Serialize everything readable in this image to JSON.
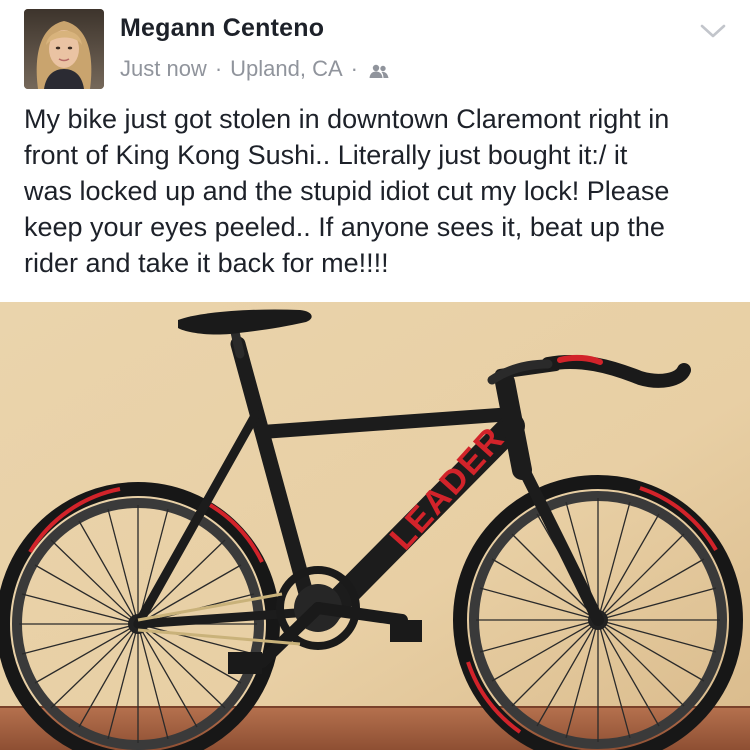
{
  "post": {
    "author": "Megann Centeno",
    "timestamp": "Just now",
    "location": "Upland, CA",
    "separator": "·",
    "audience_icon": "friends-icon",
    "menu_icon": "chevron-down-icon",
    "text": "My bike just got stolen in downtown Claremont right in\nfront of King Kong Sushi.. Literally just bought it:/ it\nwas locked up and the stupid idiot cut my lock! Please\nkeep your eyes peeled.. If anyone sees it, beat up the\nrider and take it back for me!!!!",
    "photo": {
      "frame_brand": "LEADER",
      "frame_color": "#1c1c1c",
      "accent_color": "#d2232a",
      "wall_color": "#e9d3ad"
    }
  },
  "colors": {
    "name": "#1d2129",
    "meta": "#90949c",
    "body_text": "#1d2129"
  }
}
